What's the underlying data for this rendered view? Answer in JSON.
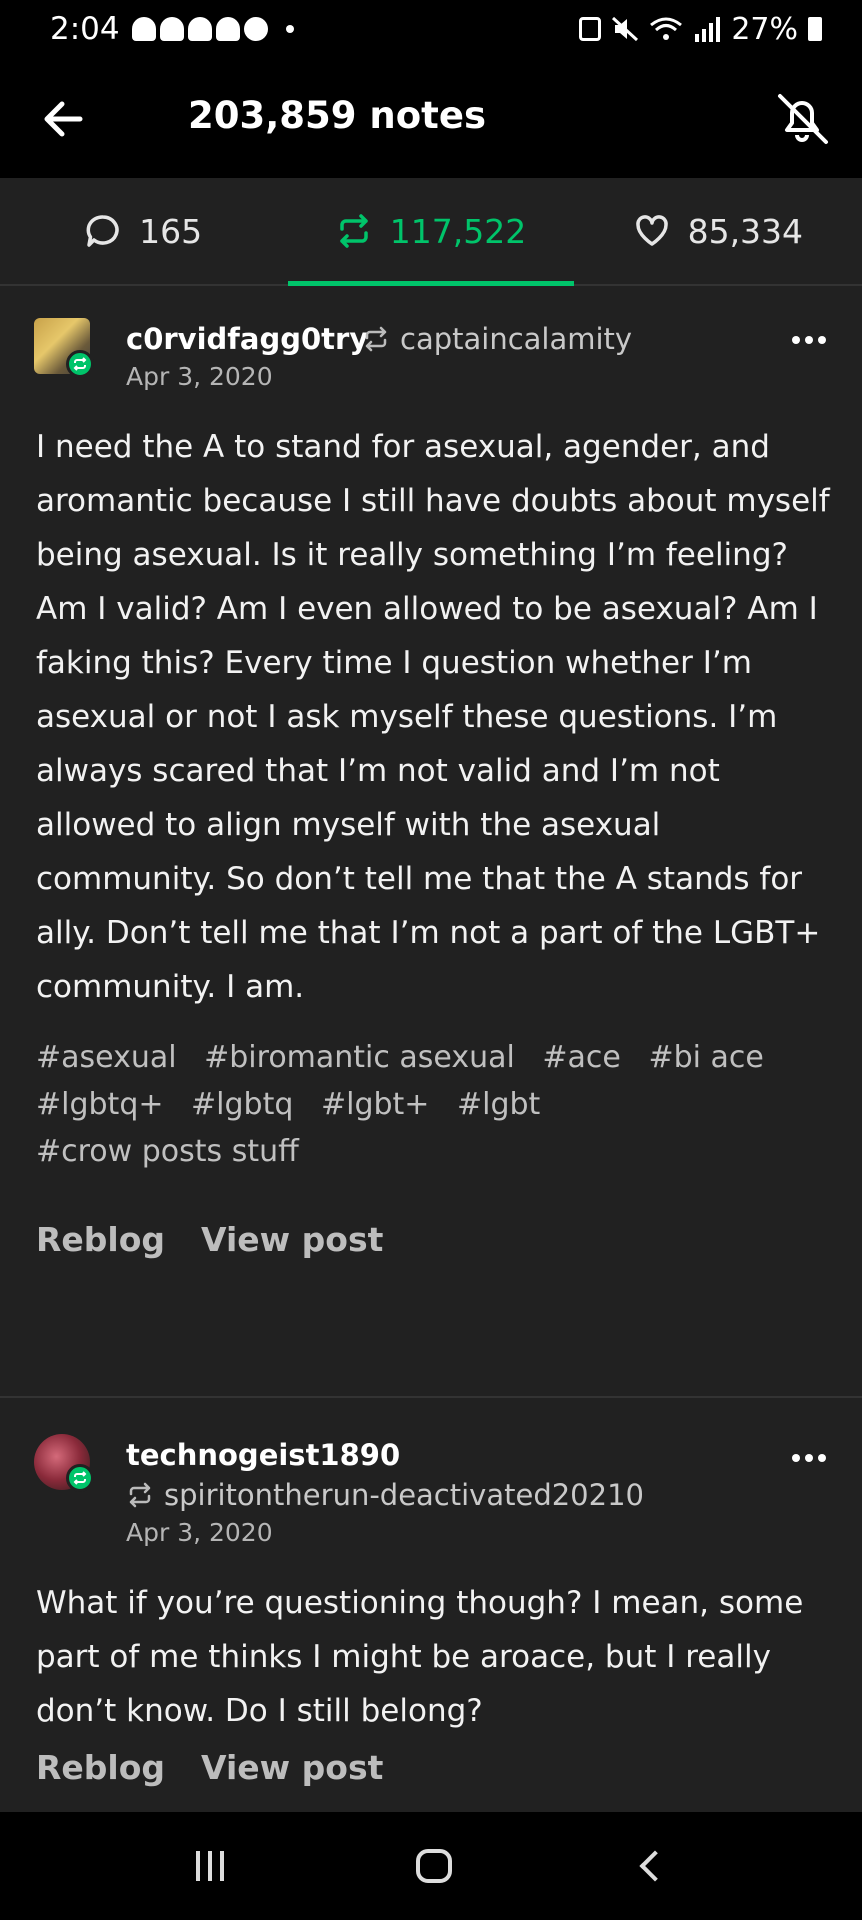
{
  "status": {
    "time": "2:04",
    "battery": "27%"
  },
  "header": {
    "title": "203,859 notes"
  },
  "tabs": [
    {
      "label": "165",
      "icon": "comment-icon"
    },
    {
      "label": "117,522",
      "icon": "reblog-icon",
      "active": true
    },
    {
      "label": "85,334",
      "icon": "heart-icon"
    }
  ],
  "posts": [
    {
      "username": "c0rvidfagg0try",
      "reblogged_from": "captaincalamity",
      "date": "Apr 3, 2020",
      "body": "I need the A to stand for asexual, agender, and aromantic because I still have doubts about myself being asexual. Is it really something I’m feeling? Am I valid? Am I even allowed to be asexual? Am I faking this? Every time I question whether I’m asexual or not I ask myself these questions. I’m always scared that I’m not valid and I’m not allowed to align myself with the asexual community. So don’t tell me that the A stands for ally. Don’t tell me that I’m not a part of the LGBT+ community. I am.",
      "tags": [
        "#asexual",
        "#biromantic asexual",
        "#ace",
        "#bi ace",
        "#lgbtq+",
        "#lgbtq",
        "#lgbt+",
        "#lgbt",
        "#crow posts stuff"
      ],
      "reblog_label": "Reblog",
      "view_label": "View post"
    },
    {
      "username": "technogeist1890",
      "reblogged_from": "spiritontherun-deactivated20210",
      "date": "Apr 3, 2020",
      "body": "What if you’re questioning though?  I mean, some part of me thinks I might be aroace, but I really don’t know.  Do I still belong?",
      "reblog_label": "Reblog",
      "view_label": "View post"
    }
  ],
  "colors": {
    "accent": "#00c46a",
    "background": "#212121"
  }
}
